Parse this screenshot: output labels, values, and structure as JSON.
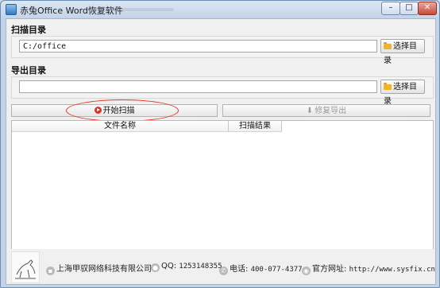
{
  "window": {
    "title": "赤兔Office Word恢复软件",
    "controls": {
      "minimize": "–",
      "maximize": "□",
      "close": "✕"
    }
  },
  "scan_dir": {
    "label": "扫描目录",
    "value": "C:/office",
    "browse_label": "选择目录"
  },
  "export_dir": {
    "label": "导出目录",
    "value": "",
    "browse_label": "选择目录"
  },
  "actions": {
    "start_scan": "开始扫描",
    "repair_export": "修复导出"
  },
  "table": {
    "columns": [
      "文件名称",
      "扫描结果"
    ],
    "rows": []
  },
  "footer": {
    "company": "上海甲驭网络科技有限公司",
    "qq_label": "QQ: ",
    "qq_value": "1253148355",
    "phone_label": "电话: ",
    "phone_value": "400-077-4377",
    "site_label": "官方网址: ",
    "site_value": "http://www.sysfix.cn"
  },
  "colors": {
    "accent": "#d9332b",
    "window_border": "#6b8db3",
    "folder": "#f0b429"
  },
  "icons": [
    "app-icon",
    "folder-icon",
    "play-icon",
    "download-icon",
    "building-icon",
    "qq-icon",
    "phone-icon",
    "globe-icon"
  ]
}
